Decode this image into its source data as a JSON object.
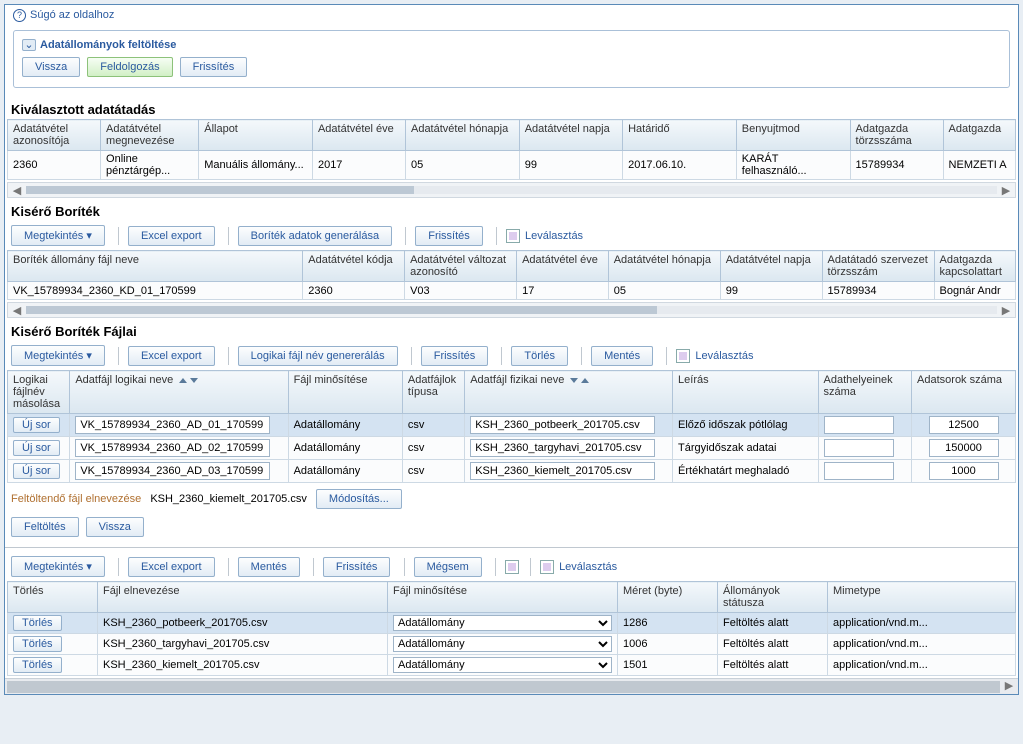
{
  "help": "Súgó az oldalhoz",
  "panel1": {
    "title": "Adatállományok feltöltése",
    "btn_back": "Vissza",
    "btn_process": "Feldolgozás",
    "btn_refresh": "Frissítés"
  },
  "selected": {
    "title": "Kiválasztott adatátadás",
    "cols": [
      "Adatátvétel azonosítója",
      "Adatátvétel megnevezése",
      "Állapot",
      "Adatátvétel éve",
      "Adatátvétel hónapja",
      "Adatátvétel napja",
      "Határidő",
      "Benyujtmod",
      "Adatgazda törzsszáma",
      "Adatgazda"
    ],
    "row": [
      "2360",
      "Online pénztárgép...",
      "Manuális állomány...",
      "2017",
      "05",
      "99",
      "2017.06.10.",
      "KARÁT felhasználó...",
      "15789934",
      "NEMZETI A"
    ]
  },
  "envelope": {
    "title": "Kisérő Boríték",
    "btn_view": "Megtekintés",
    "btn_excel": "Excel export",
    "btn_gen": "Boríték adatok generálása",
    "btn_refresh": "Frissítés",
    "btn_detach": "Leválasztás",
    "cols": [
      "Boríték állomány fájl neve",
      "Adatátvétel kódja",
      "Adatátvétel változat azonosító",
      "Adatátvétel éve",
      "Adatátvétel hónapja",
      "Adatátvétel napja",
      "Adatátadó szervezet törzsszám",
      "Adatgazda kapcsolattart"
    ],
    "row": [
      "VK_15789934_2360_KD_01_170599",
      "2360",
      "V03",
      "17",
      "05",
      "99",
      "15789934",
      "Bognár Andr"
    ]
  },
  "files": {
    "title": "Kisérő Boríték Fájlai",
    "btn_view": "Megtekintés",
    "btn_excel": "Excel export",
    "btn_gen": "Logikai fájl név genererálás",
    "btn_refresh": "Frissítés",
    "btn_delete": "Törlés",
    "btn_save": "Mentés",
    "btn_detach": "Leválasztás",
    "cols": [
      "Logikai fájlnév másolása",
      "Adatfájl logikai neve",
      "Fájl minősítése",
      "Adatfájlok típusa",
      "Adatfájl fizikai neve",
      "Leírás",
      "Adathelyeinek száma",
      "Adatsorok száma"
    ],
    "newrow": "Új sor",
    "rows": [
      {
        "logical": "VK_15789934_2360_AD_01_170599",
        "qual": "Adatállomány",
        "type": "csv",
        "phys": "KSH_2360_potbeerk_201705.csv",
        "desc": "Előző időszak pótlólag",
        "count": "12500"
      },
      {
        "logical": "VK_15789934_2360_AD_02_170599",
        "qual": "Adatállomány",
        "type": "csv",
        "phys": "KSH_2360_targyhavi_201705.csv",
        "desc": "Tárgyidőszak adatai",
        "count": "150000"
      },
      {
        "logical": "VK_15789934_2360_AD_03_170599",
        "qual": "Adatállomány",
        "type": "csv",
        "phys": "KSH_2360_kiemelt_201705.csv",
        "desc": "Értékhatárt meghaladó",
        "count": "1000"
      }
    ]
  },
  "upload": {
    "label": "Feltöltendő fájl elnevezése",
    "filename": "KSH_2360_kiemelt_201705.csv",
    "btn_modify": "Módosítás...",
    "btn_upload": "Feltöltés",
    "btn_back": "Vissza"
  },
  "bottom": {
    "btn_view": "Megtekintés",
    "btn_excel": "Excel export",
    "btn_save": "Mentés",
    "btn_refresh": "Frissítés",
    "btn_cancel": "Mégsem",
    "btn_detach": "Leválasztás",
    "cols": [
      "Törlés",
      "Fájl elnevezése",
      "Fájl minősítése",
      "Méret (byte)",
      "Állományok státusza",
      "Mimetype"
    ],
    "del": "Törlés",
    "rows": [
      {
        "name": "KSH_2360_potbeerk_201705.csv",
        "qual": "Adatállomány",
        "size": "1286",
        "status": "Feltöltés alatt",
        "mime": "application/vnd.m..."
      },
      {
        "name": "KSH_2360_targyhavi_201705.csv",
        "qual": "Adatállomány",
        "size": "1006",
        "status": "Feltöltés alatt",
        "mime": "application/vnd.m..."
      },
      {
        "name": "KSH_2360_kiemelt_201705.csv",
        "qual": "Adatállomány",
        "size": "1501",
        "status": "Feltöltés alatt",
        "mime": "application/vnd.m..."
      }
    ]
  }
}
